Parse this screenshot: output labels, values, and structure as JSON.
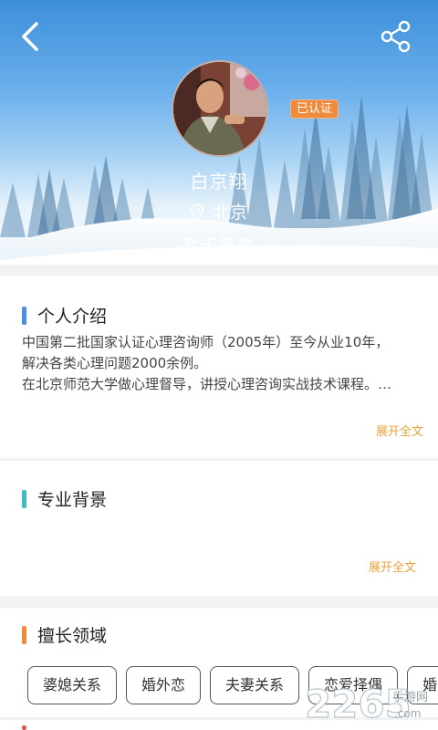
{
  "header": {
    "back_icon": "chevron-left-icon",
    "share_icon": "share-icon",
    "verified_label": "已认证",
    "name": "白京翔",
    "location": "北京",
    "signature": "暂无签名"
  },
  "intro": {
    "title": "个人介绍",
    "accent": "#4a90e2",
    "lines": [
      "中国第二批国家认证心理咨询师（2005年）至今从业10年，",
      "解决各类心理问题2000余例。",
      "在北京师范大学做心理督导，讲授心理咨询实战技术课程。…"
    ],
    "more_label": "展开全文"
  },
  "background": {
    "title": "专业背景",
    "accent": "#3dbcc4",
    "more_label": "展开全文"
  },
  "expertise": {
    "title": "擅长领域",
    "accent": "#f08a3c",
    "tags": [
      "婆媳关系",
      "婚外恋",
      "夫妻关系",
      "恋爱择偶",
      "婚"
    ]
  },
  "watermark": {
    "brand_number": "2265",
    "brand_text": "手游网",
    "domain": ".com"
  },
  "colors": {
    "link": "#e8a23a",
    "badge": "#f08a3c"
  }
}
